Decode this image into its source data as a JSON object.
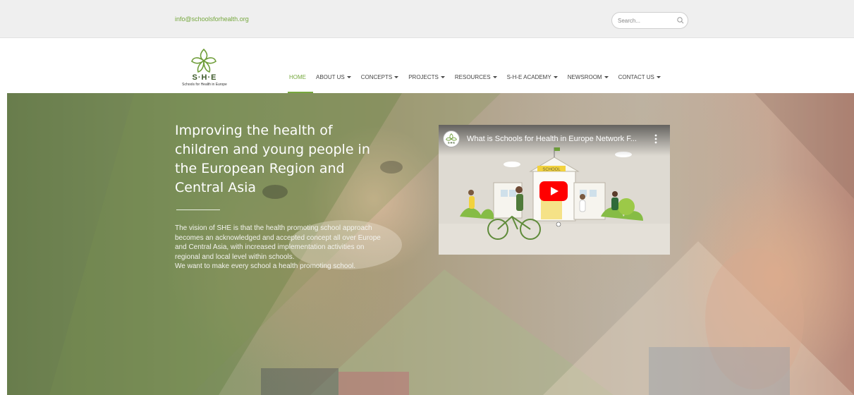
{
  "topbar": {
    "email": "info@schoolsforhealth.org",
    "search_placeholder": "Search..."
  },
  "logo": {
    "brand": "S·H·E",
    "subtitle": "Schools for Health in Europe"
  },
  "nav": {
    "items": [
      {
        "label": "HOME",
        "active": true,
        "dropdown": false
      },
      {
        "label": "ABOUT US",
        "active": false,
        "dropdown": true
      },
      {
        "label": "CONCEPTS",
        "active": false,
        "dropdown": true
      },
      {
        "label": "PROJECTS",
        "active": false,
        "dropdown": true
      },
      {
        "label": "RESOURCES",
        "active": false,
        "dropdown": true
      },
      {
        "label": "S-H-E ACADEMY",
        "active": false,
        "dropdown": true
      },
      {
        "label": "NEWSROOM",
        "active": false,
        "dropdown": true
      },
      {
        "label": "CONTACT US",
        "active": false,
        "dropdown": true
      }
    ]
  },
  "hero": {
    "headline": "Improving the health of children and young people in the European Region and Central Asia",
    "description_1": "The vision of SHE is that the health promoting school approach becomes an acknowledged and accepted concept all over Europe and Central Asia, with increased implementation activities on regional and local level within schools.",
    "description_2": "We want to make every school a health promoting school."
  },
  "video": {
    "title": "What is Schools for Health in Europe Network F...",
    "sign_text": "SCHOOL",
    "channel_text": "S·H·E"
  },
  "colors": {
    "accent": "#76a83e",
    "topbar_bg": "#efefef",
    "youtube_red": "#ff0000"
  },
  "icons": [
    "search-icon",
    "leaf-logo-icon",
    "caret-down-icon",
    "play-icon",
    "more-vert-icon"
  ]
}
